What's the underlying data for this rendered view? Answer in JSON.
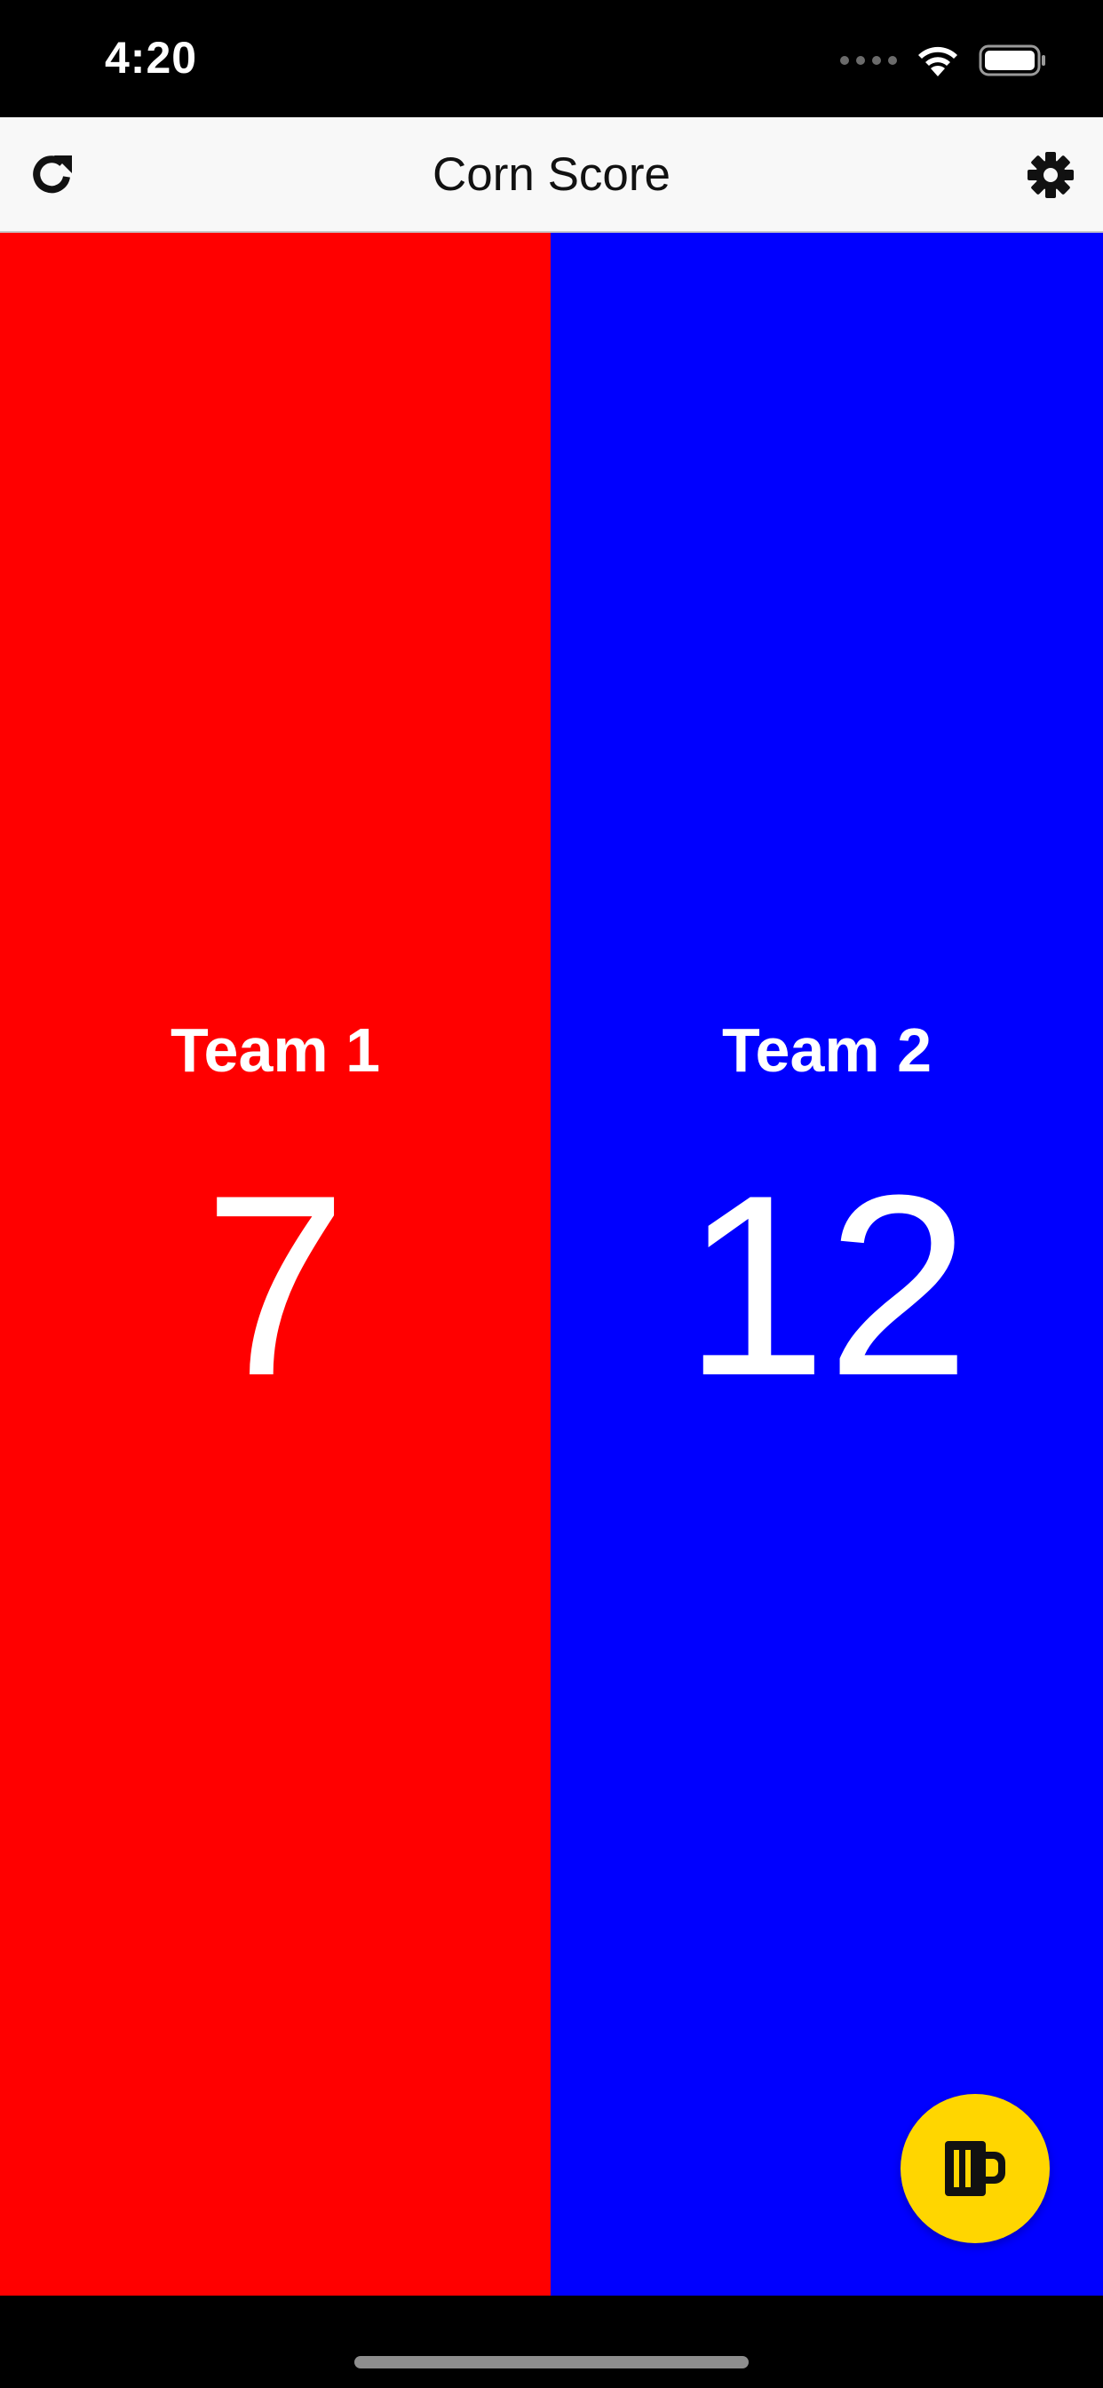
{
  "status_bar": {
    "time": "4:20",
    "icons": [
      "signal-dots-icon",
      "wifi-icon",
      "battery-icon"
    ]
  },
  "nav": {
    "title": "Corn Score",
    "left_icon": "refresh-icon",
    "right_icon": "gear-icon"
  },
  "teams": [
    {
      "name": "Team 1",
      "score": "7",
      "color": "#ff0000"
    },
    {
      "name": "Team 2",
      "score": "12",
      "color": "#0000ff"
    }
  ],
  "fab": {
    "icon": "beer-mug-icon",
    "color": "#ffd600"
  }
}
